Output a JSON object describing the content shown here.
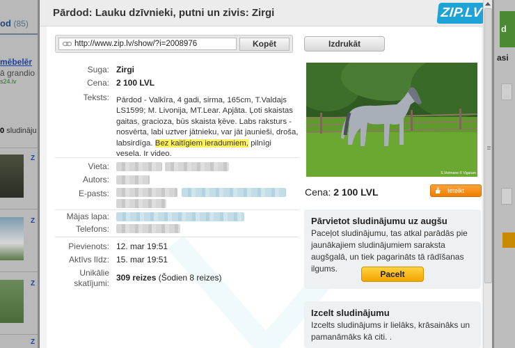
{
  "background": {
    "tab_label": "od",
    "tab_count": "(85)",
    "ad_title": "mēbelēr",
    "ad_line": "ā grandio",
    "ad_url": "s24.lv",
    "listing_count_number": "0",
    "listing_count_text": "sludināju",
    "row_marker": "Z",
    "right_green_text": "d",
    "right_heading": "asi"
  },
  "modal": {
    "title": "Pārdod: Lauku dzīvnieki, putni un zivis: Zirgi",
    "logo_text": "ZIP.LV",
    "url": "http://www.zip.lv/show/?i=2008976",
    "copy_label": "Kopēt",
    "print_label": "Izdrukāt"
  },
  "details": {
    "type_label": "Suga:",
    "type_value": "Zirgi",
    "price_label": "Cena:",
    "price_value": "2 100 LVL",
    "text_label": "Teksts:",
    "text_before": "Pārdod - Valkīra, 4 gadi, sirma, 165cm, T.Valdajs LS1599; M. Livonija, MT.Lear. Apjāta. Ļoti skaistas gaitas, gracioza, būs skaista ķēve. Labs raksturs - nosvērta, labi uztver jātnieku, var jāt jaunieši, droša, labsirdīga. ",
    "text_highlight": "Bez kaitīgiem ieradumiem,",
    "text_after": " pilnīgi vesela. Ir video.",
    "place_label": "Vieta:",
    "author_label": "Autors:",
    "email_label": "E-pasts:",
    "homepage_label": "Mājas lapa:",
    "phone_label": "Telefons:",
    "added_label": "Pievienots:",
    "added_value": "12. mar 19:51",
    "active_label": "Aktīvs līdz:",
    "active_value": "15. mar 19:51",
    "views_label_1": "Unikālie",
    "views_label_2": "skatījumi:",
    "views_value": "309 reizes",
    "views_today": " (Šodien 8 reizes)"
  },
  "photo": {
    "caption": "S.Vietmane © Viguram",
    "price_label": "Cena:",
    "price_value": "2 100 LVL",
    "like_label": "Ieteikt"
  },
  "panels": {
    "lift": {
      "title": "Pārvietot sludinājumu uz augšu",
      "text": "Paceļot sludinājumu, tas atkal parādās pie jaunākajiem sludinājumiem saraksta augšgalā, un tiek pagarināts tā rādīšanas ilgums.",
      "button": "Pacelt"
    },
    "highlight": {
      "title": "Izcelt sludinājumu",
      "text": "Izcelts sludinājums ir lielāks, krāsaināks un pamanāmāks kā citi. ."
    }
  },
  "colors": {
    "logo": "#1da3d6",
    "lift_button": "#f2a500",
    "like_button": "#f07d00",
    "highlight": "#fff35a"
  }
}
